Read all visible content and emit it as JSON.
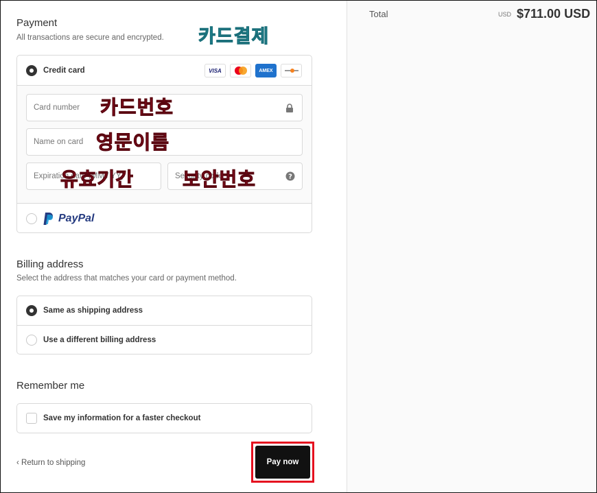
{
  "payment": {
    "title": "Payment",
    "subtitle": "All transactions are secure and encrypted.",
    "annotation": "카드결제",
    "credit_card_label": "Credit card",
    "brands": [
      "VISA",
      "",
      "AMEX",
      ""
    ],
    "fields": {
      "card_number_placeholder": "Card number",
      "name_placeholder": "Name on card",
      "expiration_placeholder": "Expiration date (MM / YY)",
      "security_placeholder": "Security code"
    },
    "annotations": {
      "card_number": "카드번호",
      "name": "영문이름",
      "expiration": "유효기간",
      "security": "보안번호"
    },
    "paypal_label": "PayPal"
  },
  "billing": {
    "title": "Billing address",
    "subtitle": "Select the address that matches your card or payment method.",
    "options": [
      "Same as shipping address",
      "Use a different billing address"
    ]
  },
  "remember": {
    "title": "Remember me",
    "option": "Save my information for a faster checkout"
  },
  "footer": {
    "return_label": "Return to shipping",
    "pay_label": "Pay now"
  },
  "summary": {
    "total_label": "Total",
    "currency": "USD",
    "total_value": "$711.00 USD"
  },
  "colors": {
    "annotation_cyan": "#2fc1d0",
    "annotation_red": "#d2152f",
    "highlight_red": "#e5101f",
    "button_black": "#111111"
  }
}
